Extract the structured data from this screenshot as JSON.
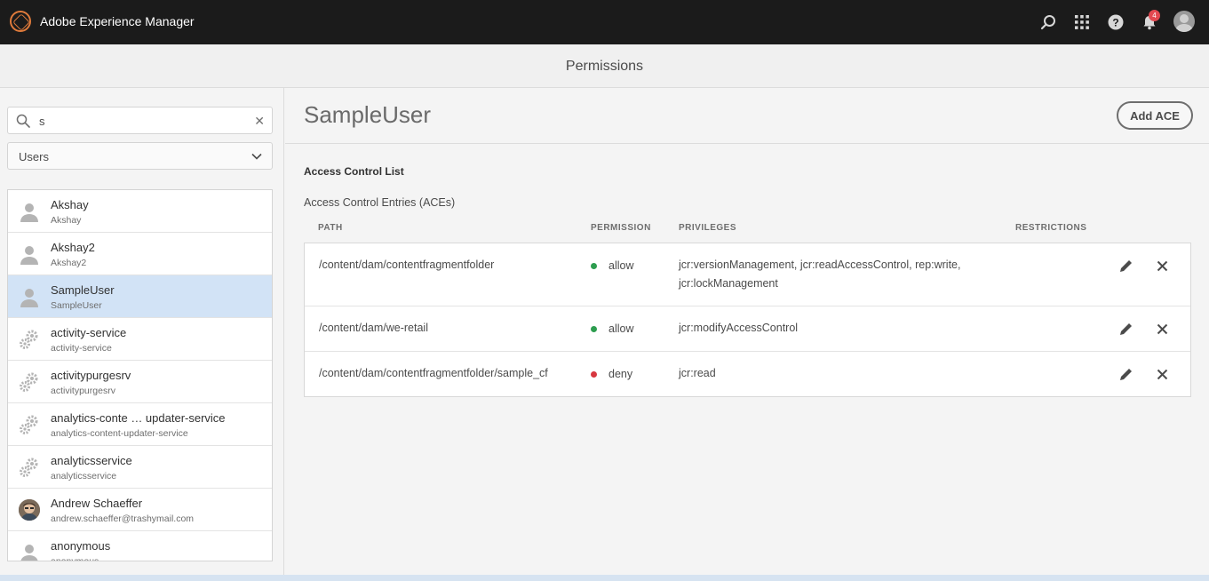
{
  "shell": {
    "app_title": "Adobe Experience Manager",
    "notification_count": "4",
    "icons": [
      "search-icon",
      "apps-grid-icon",
      "help-icon",
      "bell-icon",
      "avatar"
    ]
  },
  "page": {
    "title": "Permissions"
  },
  "sidebar": {
    "search_value": "s",
    "filter_value": "Users",
    "users": [
      {
        "name": "Akshay",
        "id": "Akshay",
        "icon": "user-icon"
      },
      {
        "name": "Akshay2",
        "id": "Akshay2",
        "icon": "user-icon"
      },
      {
        "name": "SampleUser",
        "id": "SampleUser",
        "icon": "user-icon",
        "selected": true
      },
      {
        "name": "activity-service",
        "id": "activity-service",
        "icon": "gears-icon"
      },
      {
        "name": "activitypurgesrv",
        "id": "activitypurgesrv",
        "icon": "gears-icon"
      },
      {
        "name": "analytics-conte … updater-service",
        "id": "analytics-content-updater-service",
        "icon": "gears-icon"
      },
      {
        "name": "analyticsservice",
        "id": "analyticsservice",
        "icon": "gears-icon"
      },
      {
        "name": "Andrew Schaeffer",
        "id": "andrew.schaeffer@trashymail.com",
        "icon": "photo-avatar"
      },
      {
        "name": "anonymous",
        "id": "anonymous",
        "icon": "user-icon"
      }
    ]
  },
  "main": {
    "principal": "SampleUser",
    "add_ace_label": "Add ACE",
    "acl_title": "Access Control List",
    "aces_title": "Access Control Entries (ACEs)",
    "columns": {
      "path": "PATH",
      "permission": "PERMISSION",
      "privileges": "PRIVILEGES",
      "restrictions": "RESTRICTIONS"
    },
    "entries": [
      {
        "path": "/content/dam/contentfragmentfolder",
        "permission": "allow",
        "privileges_line1": "jcr:versionManagement, jcr:readAccessControl, rep:write,",
        "privileges_line2": "jcr:lockManagement",
        "restrictions": ""
      },
      {
        "path": "/content/dam/we-retail",
        "permission": "allow",
        "privileges_line1": "jcr:modifyAccessControl",
        "privileges_line2": "",
        "restrictions": ""
      },
      {
        "path": "/content/dam/contentfragmentfolder/sample_cf",
        "permission": "deny",
        "privileges_line1": "jcr:read",
        "privileges_line2": "",
        "restrictions": ""
      }
    ]
  },
  "colors": {
    "allow": "#2d9d4f",
    "deny": "#d7373f",
    "selected_row": "#d2e3f6",
    "shell": "#1b1b1b"
  }
}
